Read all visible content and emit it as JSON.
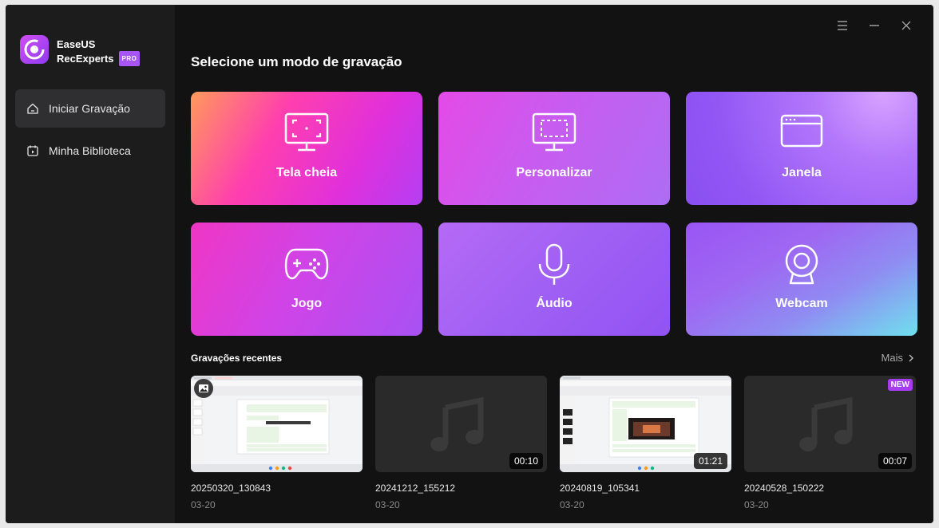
{
  "app": {
    "brand_line1": "EaseUS",
    "brand_line2": "RecExperts",
    "pro_badge": "PRO",
    "accent": "#a855f7"
  },
  "sidebar": {
    "items": [
      {
        "label": "Iniciar Gravação",
        "icon": "home-icon",
        "active": true
      },
      {
        "label": "Minha Biblioteca",
        "icon": "library-icon",
        "active": false
      }
    ]
  },
  "window_controls": [
    "menu-icon",
    "minimize-icon",
    "close-icon"
  ],
  "main": {
    "title": "Selecione um modo de gravação",
    "modes": [
      {
        "label": "Tela cheia",
        "icon": "fullscreen-monitor-icon"
      },
      {
        "label": "Personalizar",
        "icon": "custom-region-monitor-icon"
      },
      {
        "label": "Janela",
        "icon": "window-icon"
      },
      {
        "label": "Jogo",
        "icon": "gamepad-icon"
      },
      {
        "label": "Áudio",
        "icon": "microphone-icon"
      },
      {
        "label": "Webcam",
        "icon": "webcam-icon"
      }
    ]
  },
  "recent": {
    "title": "Gravações recentes",
    "more_label": "Mais",
    "items": [
      {
        "name": "20250320_130843",
        "date": "03-20",
        "type": "image",
        "duration": "",
        "is_new": false
      },
      {
        "name": "20241212_155212",
        "date": "03-20",
        "type": "audio",
        "duration": "00:10",
        "is_new": false
      },
      {
        "name": "20240819_105341",
        "date": "03-20",
        "type": "video",
        "duration": "01:21",
        "is_new": false
      },
      {
        "name": "20240528_150222",
        "date": "03-20",
        "type": "audio",
        "duration": "00:07",
        "is_new": true
      }
    ],
    "new_badge": "NEW"
  }
}
